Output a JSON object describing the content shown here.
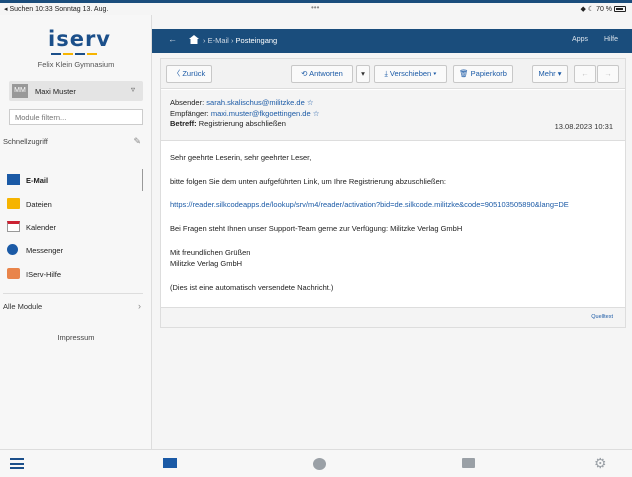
{
  "status_bar": {
    "left": "◂ Suchen  10:33  Sonntag 13. Aug.",
    "center": "•••",
    "right": "◆ ☾ 70 %"
  },
  "sidebar": {
    "logo": "iserv",
    "school": "Felix Klein Gymnasium",
    "user": {
      "initials": "MM",
      "name": "Maxi Muster"
    },
    "filter_placeholder": "Module filtern...",
    "quick_access_label": "Schnellzugriff",
    "items": [
      {
        "label": "E-Mail",
        "icon": "mail-icon",
        "active": true
      },
      {
        "label": "Dateien",
        "icon": "folder-icon",
        "active": false
      },
      {
        "label": "Kalender",
        "icon": "calendar-icon",
        "active": false
      },
      {
        "label": "Messenger",
        "icon": "messenger-icon",
        "active": false
      },
      {
        "label": "IServ-Hilfe",
        "icon": "help-icon",
        "active": false
      }
    ],
    "all_modules_label": "Alle Module",
    "impressum_label": "Impressum"
  },
  "header": {
    "crumb_parent": "E-Mail",
    "crumb_current": "Posteingang",
    "apps_label": "Apps",
    "help_label": "Hilfe"
  },
  "toolbar": {
    "back_label": "〈 Zurück",
    "reply_label": "⟲ Antworten",
    "reply_caret": "▾",
    "move_label": "⤓ Verschieben ▾",
    "trash_label": "🗑 Papierkorb",
    "more_label": "Mehr ▾",
    "prev_label": "←",
    "next_label": "→"
  },
  "mail": {
    "sender_label": "Absender:",
    "sender": "sarah.skalischus@militzke.de",
    "recipient_label": "Empfänger:",
    "recipient": "maxi.muster@fkgoettingen.de",
    "subject_label": "Betreff:",
    "subject": "Registrierung abschließen",
    "date": "13.08.2023 10:31",
    "greeting": "Sehr geehrte Leserin, sehr geehrter Leser,",
    "instruction": "bitte folgen Sie dem unten aufgeführten Link, um Ihre Registrierung abzuschließen:",
    "link": "https://reader.silkcodeapps.de/lookup/srv/m4/reader/activation?bid=de.silkcode.militzke&code=905103505890&lang=DE",
    "support": "Bei Fragen steht Ihnen unser Support-Team gerne zur Verfügung: Militzke Verlag GmbH",
    "closing": "Mit freundlichen Grüßen",
    "signature": "Militzke Verlag GmbH",
    "auto_note": "(Dies ist eine automatisch versendete Nachricht.)",
    "source_label": "Quelltext"
  },
  "colors": {
    "brand": "#1a4d7c",
    "link": "#1b5aa6"
  }
}
